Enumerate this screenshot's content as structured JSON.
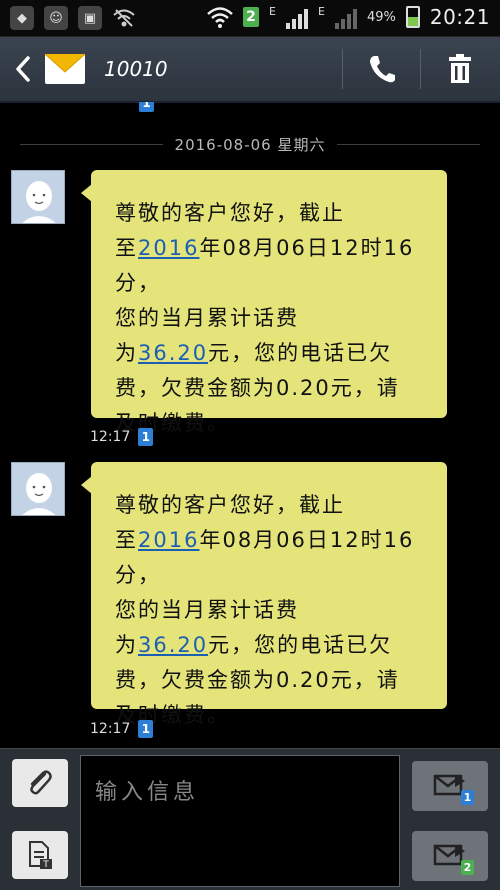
{
  "status_bar": {
    "sim_badge": "2",
    "network_type_1": "E",
    "network_type_2": "E",
    "battery_percent": "49%",
    "battery_level": 0.49,
    "time": "20:21"
  },
  "header": {
    "title": "10010",
    "icons": {
      "back": "back-arrow-icon",
      "contact": "envelope-icon",
      "call": "phone-icon",
      "delete": "trash-icon"
    }
  },
  "conversation": {
    "date_separator": "2016-08-06  星期六",
    "messages": [
      {
        "line1": "尊敬的客户您好，截止",
        "line2_prefix": "至",
        "line2_year": "2016",
        "line2_rest": "年08月06日12时16分，",
        "line3": "您的当月累计话费",
        "line4_prefix": "为",
        "line4_amount": "36.20",
        "line4_rest": "元，您的电话已欠",
        "line5": "费，欠费金额为0.20元，请",
        "line6": "及时缴费。",
        "time": "12:17",
        "sim": "1"
      },
      {
        "line1": "尊敬的客户您好，截止",
        "line2_prefix": "至",
        "line2_year": "2016",
        "line2_rest": "年08月06日12时16分，",
        "line3": "您的当月累计话费",
        "line4_prefix": "为",
        "line4_amount": "36.20",
        "line4_rest": "元，您的电话已欠",
        "line5": "费，欠费金额为0.20元，请",
        "line6": "及时缴费。",
        "time": "12:17",
        "sim": "1"
      }
    ],
    "partial_top_sim": "1"
  },
  "compose": {
    "placeholder": "输入信息",
    "send_sim1": "1",
    "send_sim2": "2",
    "colors": {
      "sim1": "#2d7fd6",
      "sim2": "#4caf50"
    }
  }
}
